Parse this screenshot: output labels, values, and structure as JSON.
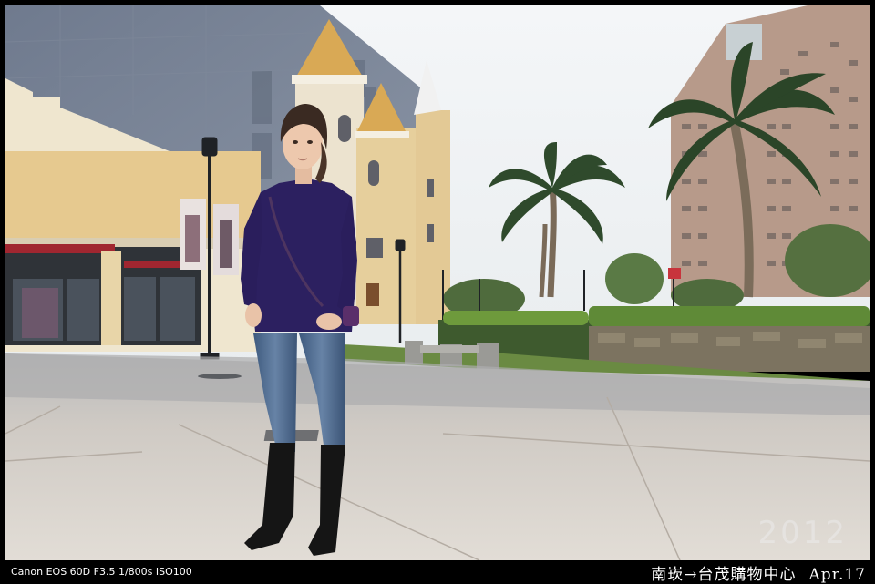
{
  "photo": {
    "year_watermark": "2012"
  },
  "footer": {
    "exif": "Canon EOS 60D  F3.5 1/800s ISO100",
    "caption": "南崁→台茂購物中心",
    "date": "Apr.17"
  }
}
